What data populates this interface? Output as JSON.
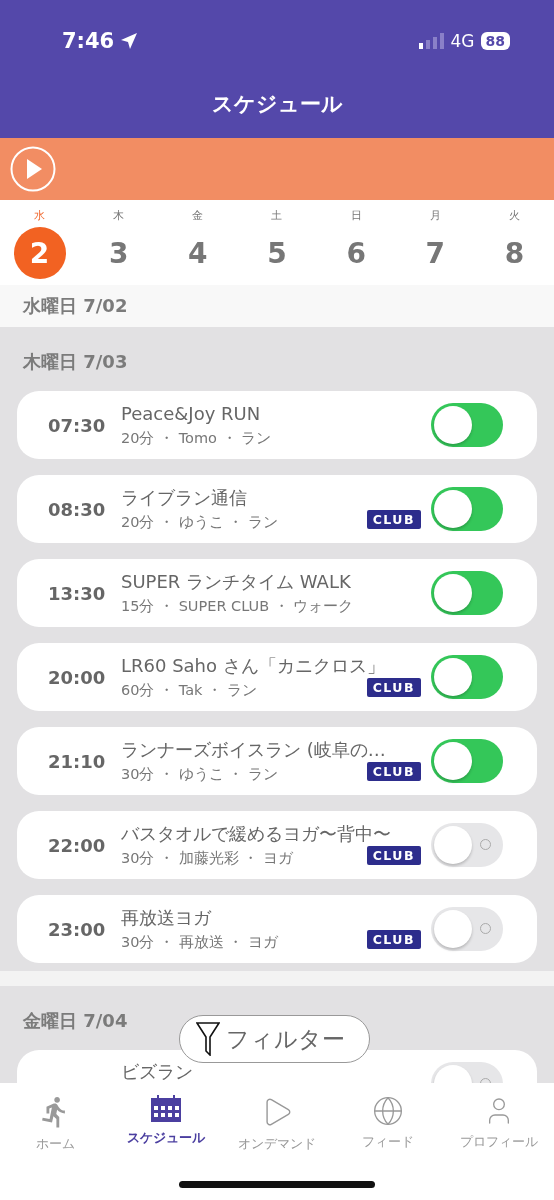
{
  "status_bar": {
    "time": "7:46",
    "network": "4G",
    "battery": "88"
  },
  "header": {
    "title": "スケジュール"
  },
  "week": [
    {
      "weekday": "水",
      "day": "2",
      "selected": true
    },
    {
      "weekday": "木",
      "day": "3",
      "selected": false
    },
    {
      "weekday": "金",
      "day": "4",
      "selected": false
    },
    {
      "weekday": "土",
      "day": "5",
      "selected": false
    },
    {
      "weekday": "日",
      "day": "6",
      "selected": false
    },
    {
      "weekday": "月",
      "day": "7",
      "selected": false
    },
    {
      "weekday": "火",
      "day": "8",
      "selected": false
    }
  ],
  "days": [
    {
      "heading": "水曜日 7/02"
    },
    {
      "heading": "木曜日 7/03",
      "events": [
        {
          "time": "07:30",
          "title": "Peace&Joy RUN",
          "details": "20分 ・ Tomo ・ ラン",
          "on": true
        },
        {
          "time": "08:30",
          "title": "ライブラン通信",
          "details": "20分 ・ ゆうこ ・ ラン",
          "club_label": "CLUB",
          "on": true
        },
        {
          "time": "13:30",
          "title": "SUPER ランチタイム WALK",
          "details": "15分 ・ SUPER CLUB ・ ウォーク",
          "on": true
        },
        {
          "time": "20:00",
          "title": "LR60 Saho さん「カニクロス」",
          "details": "60分 ・ Tak ・ ラン",
          "club_label": "CLUB",
          "on": true
        },
        {
          "time": "21:10",
          "title": "ランナーズボイスラン (岐阜の…",
          "details": "30分 ・ ゆうこ ・ ラン",
          "club_label": "CLUB",
          "on": true
        },
        {
          "time": "22:00",
          "title": "バスタオルで緩めるヨガ〜背中〜",
          "details": "30分 ・ 加藤光彩 ・ ヨガ",
          "club_label": "CLUB",
          "on": false
        },
        {
          "time": "23:00",
          "title": "再放送ヨガ",
          "details": "30分 ・ 再放送 ・ ヨガ",
          "club_label": "CLUB",
          "on": false
        }
      ]
    },
    {
      "heading": "金曜日 7/04",
      "events": [
        {
          "title": "ビズラン",
          "on": false
        }
      ]
    }
  ],
  "filter_button": {
    "label": "フィルター"
  },
  "tab_bar": [
    {
      "label": "ホーム",
      "selected": false
    },
    {
      "label": "スケジュール",
      "selected": true
    },
    {
      "label": "オンデマンド",
      "selected": false
    },
    {
      "label": "フィード",
      "selected": false
    },
    {
      "label": "プロフィール",
      "selected": false
    }
  ]
}
